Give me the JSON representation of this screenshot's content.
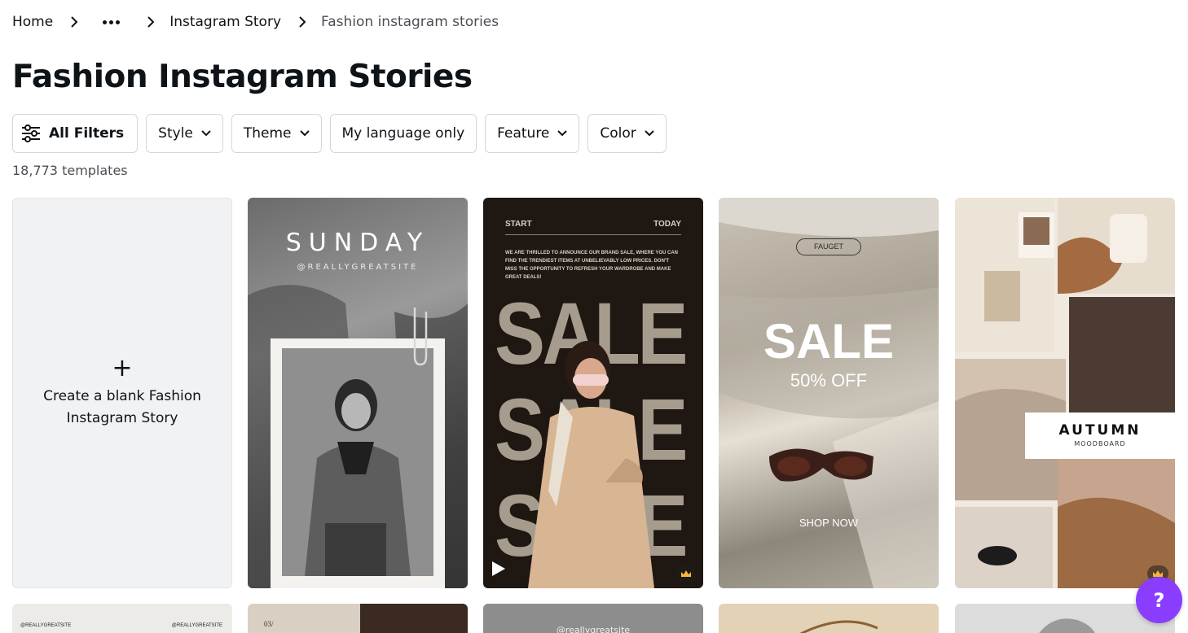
{
  "breadcrumb": {
    "home": "Home",
    "middle": "Instagram Story",
    "current": "Fashion instagram stories"
  },
  "page": {
    "title": "Fashion Instagram Stories",
    "count": "18,773 templates"
  },
  "filters": {
    "all": "All Filters",
    "style": "Style",
    "theme": "Theme",
    "language": "My language only",
    "feature": "Feature",
    "color": "Color"
  },
  "blank_card": {
    "plus": "+",
    "label": "Create a blank Fashion Instagram Story"
  },
  "templates": [
    {
      "title": "SUNDAY",
      "subtitle": "@REALLYGREATSITE"
    },
    {
      "top_left": "START",
      "top_right": "TODAY",
      "body": "WE ARE THRILLED TO ANNOUNCE OUR BRAND SALE, WHERE YOU CAN FIND THE TRENDIEST ITEMS AT UNBELIEVABLY LOW PRICES. DON'T MISS THE OPPORTUNITY TO REFRESH YOUR WARDROBE AND MAKE GREAT DEALS!",
      "headline": "SALE"
    },
    {
      "brand": "FAUGET",
      "headline": "SALE",
      "discount": "50% OFF",
      "cta": "SHOP NOW"
    },
    {
      "title": "AUTUMN",
      "subtitle": "MOODBOARD"
    }
  ],
  "row2": [
    {
      "left": "@REALLYGREATSITE",
      "right": "@REALLYGREATSITE"
    },
    {
      "label": "03/"
    },
    {
      "label": "@reallygreatsite"
    }
  ],
  "help": {
    "label": "?"
  },
  "colors": {
    "accent": "#8b3dff",
    "text": "#0e1318",
    "muted": "#4a4f55"
  }
}
